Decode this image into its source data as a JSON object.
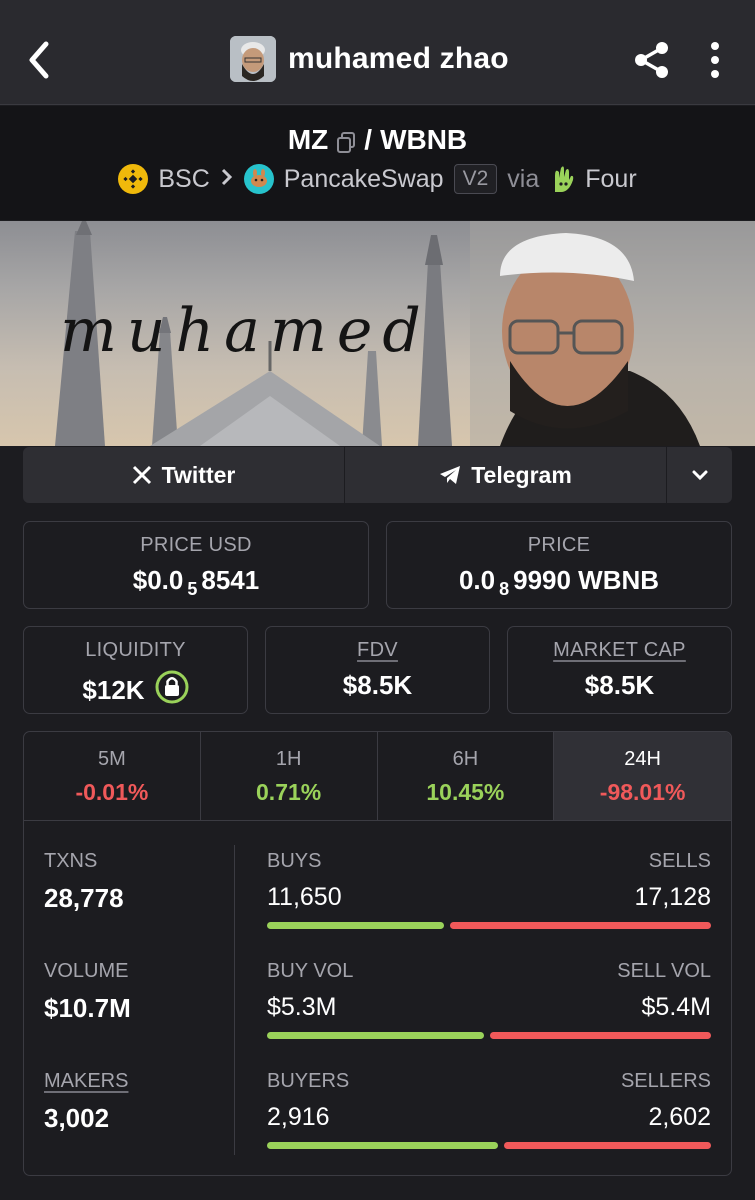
{
  "header": {
    "name": "muhamed zhao"
  },
  "pair": {
    "base": "MZ",
    "separator": "/",
    "quote": "WBNB",
    "chain": "BSC",
    "dex": "PancakeSwap",
    "version": "V2",
    "via_label": "via",
    "launchpad": "Four"
  },
  "banner": {
    "script_text": "muhamed"
  },
  "social": {
    "twitter": "Twitter",
    "telegram": "Telegram"
  },
  "price": {
    "usd_label": "PRICE USD",
    "usd_prefix": "$0.0",
    "usd_zeros": "5",
    "usd_digits": "8541",
    "native_label": "PRICE",
    "native_prefix": "0.0",
    "native_zeros": "8",
    "native_digits": "9990 WBNB"
  },
  "metrics": {
    "liquidity_label": "LIQUIDITY",
    "liquidity_value": "$12K",
    "fdv_label": "FDV",
    "fdv_value": "$8.5K",
    "mcap_label": "MARKET CAP",
    "mcap_value": "$8.5K"
  },
  "timeframes": [
    {
      "label": "5M",
      "value": "-0.01%"
    },
    {
      "label": "1H",
      "value": "0.71%"
    },
    {
      "label": "6H",
      "value": "10.45%"
    },
    {
      "label": "24H",
      "value": "-98.01%"
    }
  ],
  "txns": {
    "txns_label": "TXNS",
    "txns_value": "28,778",
    "volume_label": "VOLUME",
    "volume_value": "$10.7M",
    "makers_label": "MAKERS",
    "makers_value": "3,002",
    "buys_label": "BUYS",
    "buys_value": "11,650",
    "buys_fraction": 0.405,
    "sells_label": "SELLS",
    "sells_value": "17,128",
    "buyvol_label": "BUY VOL",
    "buyvol_value": "$5.3M",
    "buyvol_fraction": 0.495,
    "sellvol_label": "SELL VOL",
    "sellvol_value": "$5.4M",
    "buyers_label": "BUYERS",
    "buyers_value": "2,916",
    "buyers_fraction": 0.528,
    "sellers_label": "SELLERS",
    "sellers_value": "2,602"
  },
  "colors": {
    "positive": "#9ad25a",
    "negative": "#f0595a",
    "bnb": "#f0b90b"
  }
}
